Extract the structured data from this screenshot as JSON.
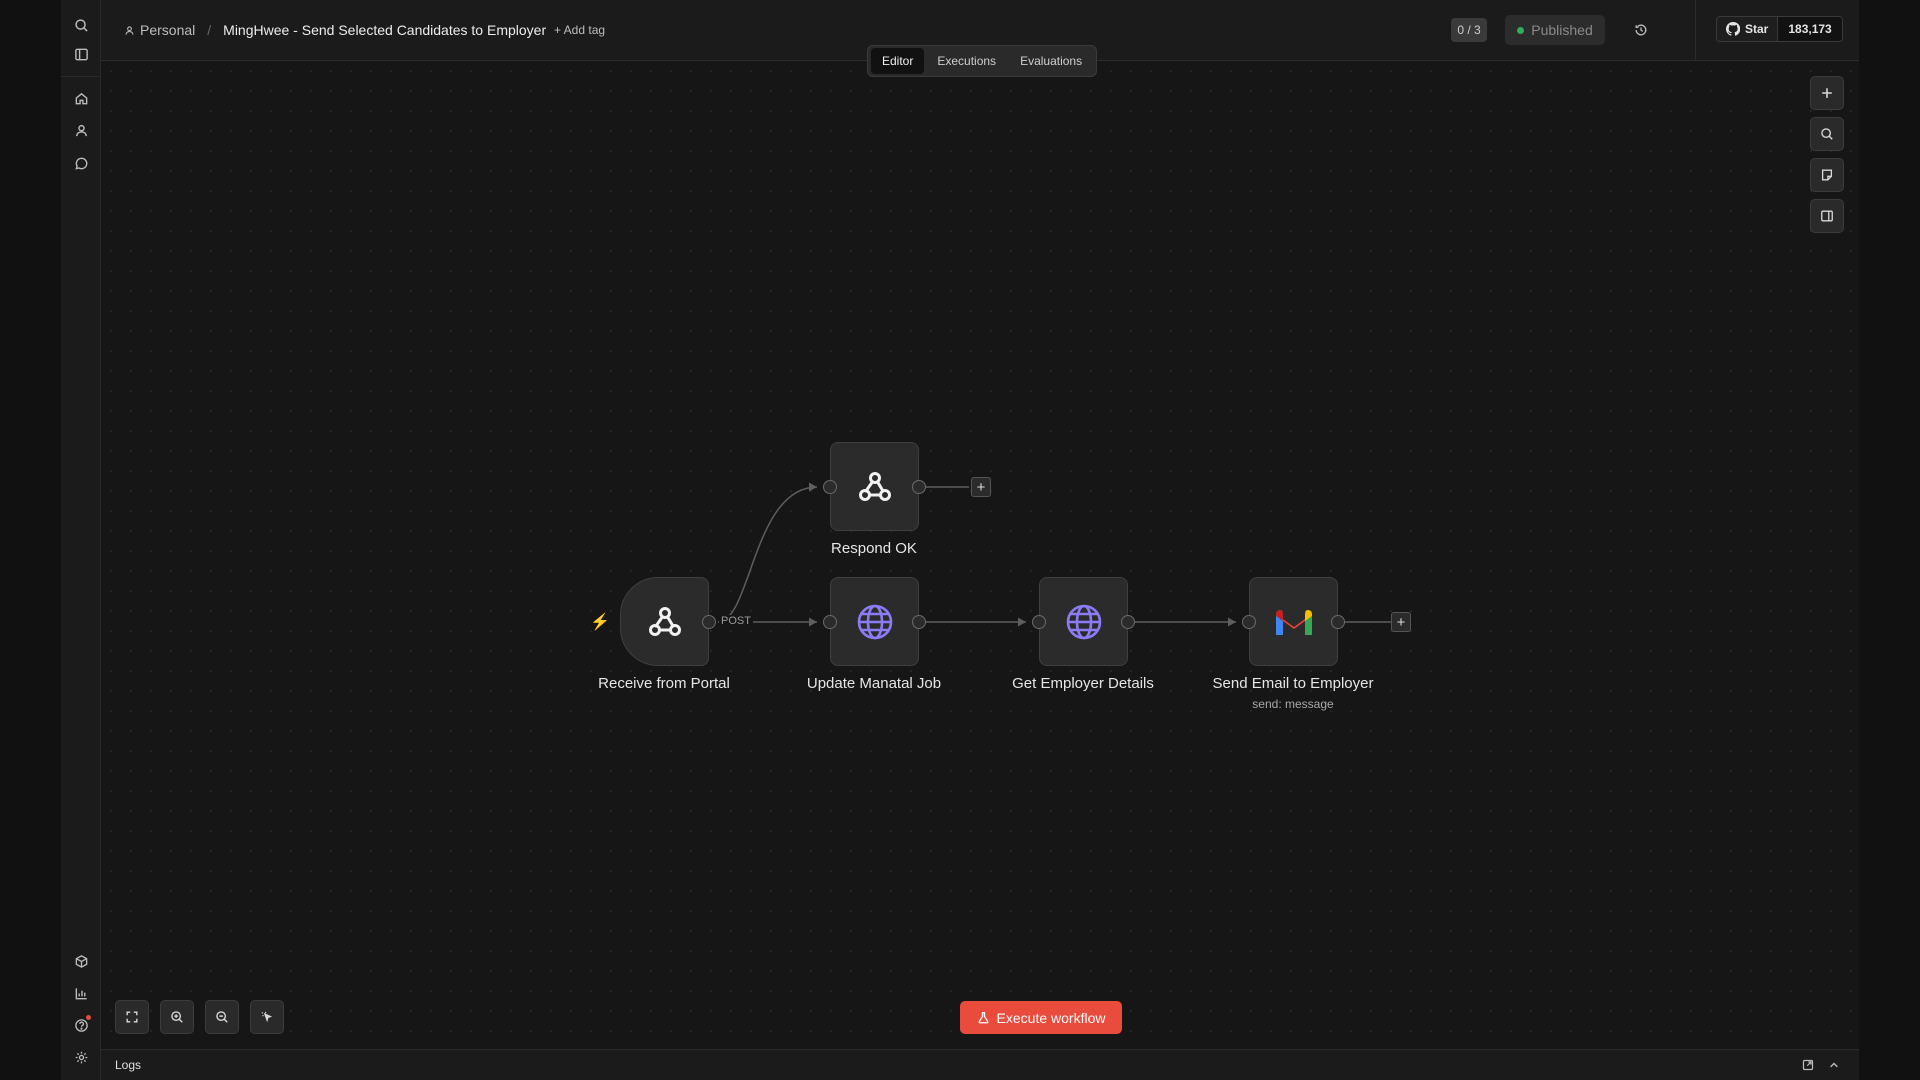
{
  "header": {
    "project": "Personal",
    "workflow_title": "MingHwee - Send Selected Candidates to Employer",
    "add_tag": "+ Add tag",
    "counter": "0 / 3",
    "status": "Published",
    "github_star_label": "Star",
    "github_star_count": "183,173"
  },
  "tabs": [
    "Editor",
    "Executions",
    "Evaluations"
  ],
  "active_tab": "Editor",
  "nodes": [
    {
      "label": "Receive from Portal",
      "icon": "webhook-icon"
    },
    {
      "label": "Respond OK",
      "icon": "webhook-icon"
    },
    {
      "label": "Update Manatal Job",
      "icon": "globe-icon"
    },
    {
      "label": "Get Employer Details",
      "icon": "globe-icon"
    },
    {
      "label": "Send Email to Employer",
      "subtitle": "send: message",
      "icon": "gmail-icon"
    }
  ],
  "edge_label": "POST",
  "execute_button": "Execute workflow",
  "logs_label": "Logs",
  "colors": {
    "accent": "#e94b3c",
    "published_dot": "#2fae5a",
    "globe": "#8b7cf6"
  }
}
